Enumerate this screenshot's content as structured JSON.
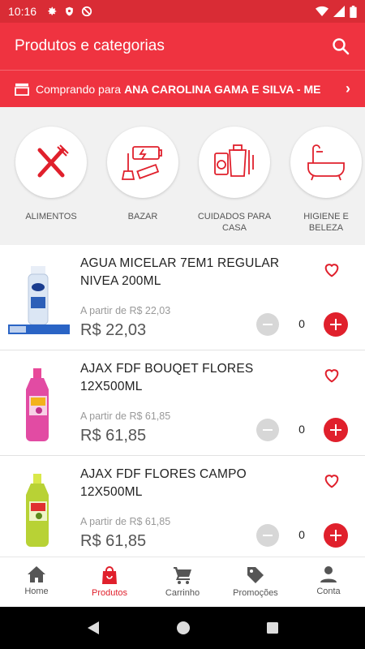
{
  "status_bar": {
    "time": "10:16",
    "icons": [
      "gear-icon",
      "shield-icon",
      "blocked-icon",
      "wifi-icon",
      "signal-icon",
      "battery-icon"
    ]
  },
  "app_bar": {
    "title": "Produtos e categorias",
    "action_icon": "search-icon"
  },
  "buying_bar": {
    "prefix": "Comprando para",
    "customer": "ANA CAROLINA GAMA E SILVA - ME",
    "chevron": "›"
  },
  "categories": [
    {
      "label": "ALIMENTOS",
      "icon": "cutlery-icon"
    },
    {
      "label": "BAZAR",
      "icon": "bazar-icon"
    },
    {
      "label": "CUIDADOS PARA CASA",
      "icon": "house-care-icon"
    },
    {
      "label": "HIGIENE E BELEZA",
      "icon": "bathtub-icon"
    }
  ],
  "products": [
    {
      "name": "AGUA MICELAR 7EM1 REGULAR NIVEA 200ML",
      "from_label": "A partir de R$ 22,03",
      "price": "R$ 22,03",
      "qty": "0",
      "image": "nivea-micellar-bottle"
    },
    {
      "name": "AJAX FDF BOUQET FLORES 12X500ML",
      "from_label": "A partir de R$ 61,85",
      "price": "R$ 61,85",
      "qty": "0",
      "image": "ajax-pink-bottle"
    },
    {
      "name": "AJAX FDF FLORES CAMPO 12X500ML",
      "from_label": "A partir de R$ 61,85",
      "price": "R$ 61,85",
      "qty": "0",
      "image": "ajax-green-bottle"
    }
  ],
  "bottom_nav": [
    {
      "label": "Home",
      "icon": "home-icon",
      "active": false
    },
    {
      "label": "Produtos",
      "icon": "shopping-bag-icon",
      "active": true
    },
    {
      "label": "Carrinho",
      "icon": "cart-icon",
      "active": false
    },
    {
      "label": "Promoções",
      "icon": "tag-icon",
      "active": false
    },
    {
      "label": "Conta",
      "icon": "person-icon",
      "active": false
    }
  ],
  "colors": {
    "primary": "#ef3340",
    "status": "#d92c35",
    "accent": "#e0202c",
    "muted": "#d7d7d7"
  }
}
